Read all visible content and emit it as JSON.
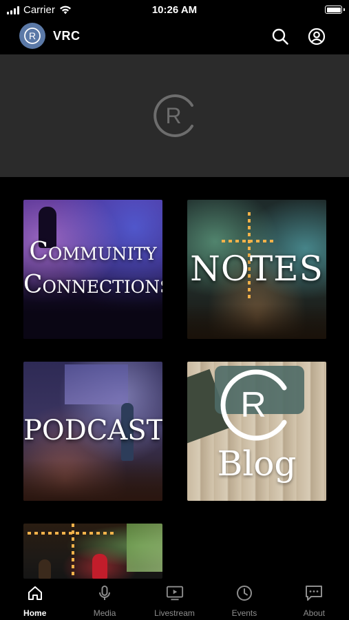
{
  "status_bar": {
    "carrier": "Carrier",
    "time": "10:26 AM",
    "battery_level": 1.0
  },
  "header": {
    "title": "VRC",
    "logo_letter": "R",
    "icons": [
      "search-icon",
      "account-icon"
    ]
  },
  "banner": {
    "logo_letter": "R"
  },
  "tiles": [
    {
      "id": "community",
      "lines": [
        "Community",
        "Connections"
      ]
    },
    {
      "id": "notes",
      "label": "NOTES"
    },
    {
      "id": "podcast",
      "label": "PODCAST"
    },
    {
      "id": "blog",
      "letter": "R",
      "label": "Blog"
    },
    {
      "id": "worship"
    }
  ],
  "tab_bar": {
    "active": "Home",
    "items": [
      {
        "label": "Home",
        "icon": "home-icon"
      },
      {
        "label": "Media",
        "icon": "microphone-icon"
      },
      {
        "label": "Livestream",
        "icon": "livestream-icon"
      },
      {
        "label": "Events",
        "icon": "clock-icon"
      },
      {
        "label": "About",
        "icon": "chat-icon"
      }
    ]
  },
  "colors": {
    "background": "#000000",
    "banner": "#2b2b2b",
    "logo_blue": "#5b79a7",
    "inactive_tab": "#8e8e8e"
  }
}
